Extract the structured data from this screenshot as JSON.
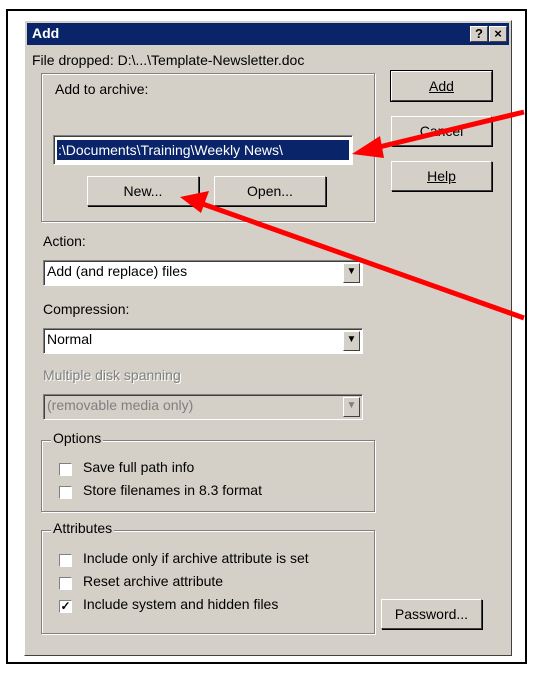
{
  "dialog": {
    "title": "Add",
    "help_glyph": "?",
    "close_glyph": "×"
  },
  "file_dropped": "File dropped: D:\\...\\Template-Newsletter.doc",
  "buttons": {
    "add": "Add",
    "cancel": "Cancel",
    "help": "Help",
    "new": "New...",
    "open": "Open...",
    "password": "Password..."
  },
  "archive": {
    "label": "Add to archive:",
    "value": ":\\Documents\\Training\\Weekly News\\"
  },
  "action": {
    "label": "Action:",
    "value": "Add (and replace) files"
  },
  "compression": {
    "label": "Compression:",
    "value": "Normal"
  },
  "spanning": {
    "label": "Multiple disk spanning",
    "value": "(removable media only)"
  },
  "options": {
    "title": "Options",
    "items": [
      {
        "label": "Save full path info",
        "checked": false
      },
      {
        "label": "Store filenames in 8.3 format",
        "checked": false
      }
    ]
  },
  "attributes": {
    "title": "Attributes",
    "items": [
      {
        "label": "Include only if archive attribute is set",
        "checked": false
      },
      {
        "label": "Reset archive attribute",
        "checked": false
      },
      {
        "label": "Include system and hidden files",
        "checked": true
      }
    ]
  },
  "colors": {
    "titlebar": "#0a246a",
    "dialog_bg": "#d4d0c8",
    "annotation_arrow": "#ff0000"
  }
}
